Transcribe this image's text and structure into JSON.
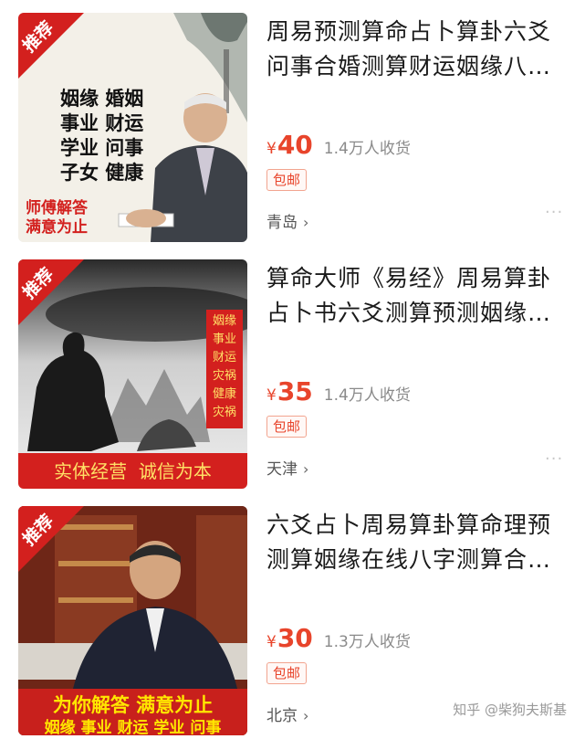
{
  "products": [
    {
      "title": "周易预测算命占卜算卦六爻问事合婚测算财运姻缘八…",
      "price_symbol": "¥",
      "price": "40",
      "sold": "1.4万人收货",
      "badge": "包邮",
      "location": "青岛",
      "ribbon": "推荐",
      "img_lines": [
        "姻缘 婚姻",
        "事业 财运",
        "学业 问事",
        "子女 健康"
      ],
      "img_footer": [
        "师傅解答",
        "满意为止"
      ]
    },
    {
      "title": "算命大师《易经》周易算卦占卜书六爻测算预测姻缘…",
      "price_symbol": "¥",
      "price": "35",
      "sold": "1.4万人收货",
      "badge": "包邮",
      "location": "天津",
      "ribbon": "推荐",
      "img_side": [
        "姻缘",
        "事业",
        "财运",
        "灾祸",
        "健康",
        "灾祸"
      ],
      "img_banner": "实体经营  诚信为本"
    },
    {
      "title": "六爻占卜周易算卦算命理预测算姻缘在线八字测算合…",
      "price_symbol": "¥",
      "price": "30",
      "sold": "1.3万人收货",
      "badge": "包邮",
      "location": "北京",
      "ribbon": "推荐",
      "img_banner_top": "为你解答 满意为止",
      "img_banner_bottom": "姻缘 事业 财运 学业 问事"
    }
  ],
  "watermark": "知乎 @柴狗夫斯基",
  "more_icon": "ellipsis-icon",
  "colors": {
    "price": "#e8442b",
    "ribbon": "#d3201e"
  }
}
